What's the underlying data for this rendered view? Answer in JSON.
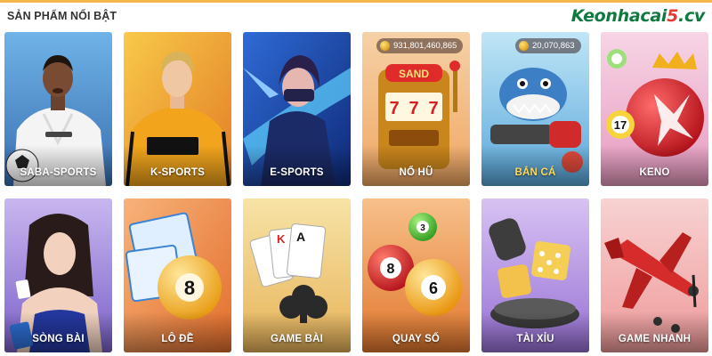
{
  "header": {
    "section_title": "SẢN PHẨM NỔI BẬT",
    "brand_main": "Keonhacai",
    "brand_five": "5",
    "brand_tld": ".cv"
  },
  "colors": {
    "accent_line": "#f3b64a",
    "brand_green": "#0f7a40",
    "brand_red": "#e23b2e",
    "highlight_label": "#ffd95a"
  },
  "cards": [
    {
      "label": "SABA-SPORTS",
      "icon": "football-player-real-madrid-icon"
    },
    {
      "label": "K-SPORTS",
      "icon": "football-player-wolves-icon"
    },
    {
      "label": "E-SPORTS",
      "icon": "esports-hero-icon"
    },
    {
      "label": "NỔ HŨ",
      "icon": "slot-machine-icon",
      "balance": "931,801,460,865"
    },
    {
      "label": "BẮN CÁ",
      "icon": "shark-cannon-icon",
      "balance": "20,070,863",
      "highlighted": true
    },
    {
      "label": "KENO",
      "icon": "keno-balls-icon"
    },
    {
      "label": "SÒNG BÀI",
      "icon": "casino-dealer-icon"
    },
    {
      "label": "LÔ ĐỀ",
      "icon": "lottery-ball-8-icon"
    },
    {
      "label": "GAME BÀI",
      "icon": "playing-cards-icon"
    },
    {
      "label": "QUAY SỐ",
      "icon": "lottery-balls-icon"
    },
    {
      "label": "TÀI XỈU",
      "icon": "dice-icon"
    },
    {
      "label": "GAME NHANH",
      "icon": "airplane-icon"
    }
  ]
}
